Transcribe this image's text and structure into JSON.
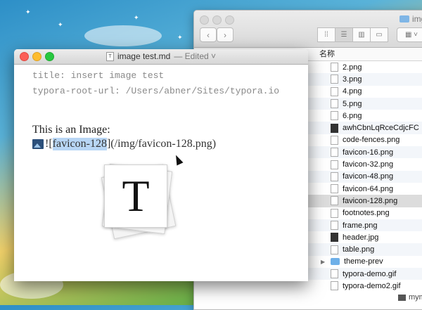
{
  "finder": {
    "title": "img",
    "column_header": "名称",
    "files": [
      {
        "name": "2.png",
        "icon": "image-file-icon"
      },
      {
        "name": "3.png",
        "icon": "image-file-icon"
      },
      {
        "name": "4.png",
        "icon": "image-file-icon"
      },
      {
        "name": "5.png",
        "icon": "image-file-icon"
      },
      {
        "name": "6.png",
        "icon": "image-file-icon"
      },
      {
        "name": "awhCbnLqRceCdjcFC",
        "icon": "dark-image-file-icon"
      },
      {
        "name": "code-fences.png",
        "icon": "image-file-icon"
      },
      {
        "name": "favicon-16.png",
        "icon": "image-file-icon"
      },
      {
        "name": "favicon-32.png",
        "icon": "image-file-icon"
      },
      {
        "name": "favicon-48.png",
        "icon": "image-file-icon"
      },
      {
        "name": "favicon-64.png",
        "icon": "image-file-icon"
      },
      {
        "name": "favicon-128.png",
        "icon": "image-file-icon",
        "selected": true
      },
      {
        "name": "footnotes.png",
        "icon": "image-file-icon"
      },
      {
        "name": "frame.png",
        "icon": "image-file-icon"
      },
      {
        "name": "header.jpg",
        "icon": "dark-image-file-icon"
      },
      {
        "name": "table.png",
        "icon": "image-file-icon"
      },
      {
        "name": "theme-prev",
        "icon": "folder-icon"
      },
      {
        "name": "typora-demo.gif",
        "icon": "image-file-icon"
      },
      {
        "name": "typora-demo2.gif",
        "icon": "image-file-icon"
      }
    ],
    "bottom_label": "mymi"
  },
  "editor": {
    "doc_name": "image test.md",
    "status": "— Edited ˅",
    "front_matter": [
      "title: insert image test",
      "typora-root-url: /Users/abner/Sites/typora.io"
    ],
    "paragraph": "This is an Image:",
    "markdown_prefix": "![",
    "alt_text": "favicon-128",
    "markdown_suffix": "](/img/favicon-128.png)",
    "logo_letter": "T"
  }
}
